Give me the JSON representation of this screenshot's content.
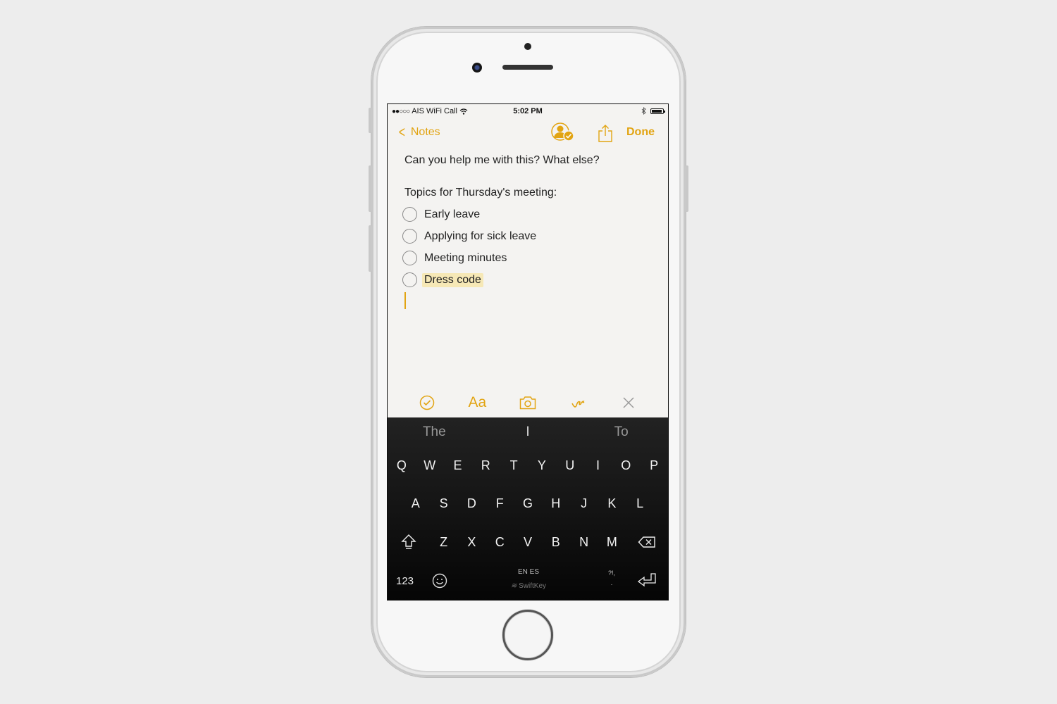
{
  "status_bar": {
    "carrier": "AIS WiFi Call",
    "signal_dots": "●●○○○",
    "time": "5:02 PM"
  },
  "nav": {
    "back_label": "Notes",
    "done_label": "Done"
  },
  "note": {
    "line1": "Can you help me with this? What else?",
    "heading": "Topics for Thursday's meeting:",
    "checklist": [
      {
        "label": "Early leave",
        "checked": false
      },
      {
        "label": "Applying for sick leave",
        "checked": false
      },
      {
        "label": "Meeting minutes",
        "checked": false
      },
      {
        "label": "Dress code",
        "checked": false,
        "highlighted": true
      }
    ]
  },
  "toolbar": {
    "items": [
      "checklist-icon",
      "text-format-icon",
      "camera-icon",
      "sketch-icon",
      "close-icon"
    ],
    "format_label": "Aa"
  },
  "keyboard": {
    "predictions": [
      "The",
      "I",
      "To"
    ],
    "row1": [
      "Q",
      "W",
      "E",
      "R",
      "T",
      "Y",
      "U",
      "I",
      "O",
      "P"
    ],
    "row2": [
      "A",
      "S",
      "D",
      "F",
      "G",
      "H",
      "J",
      "K",
      "L"
    ],
    "row3": [
      "Z",
      "X",
      "C",
      "V",
      "B",
      "N",
      "M"
    ],
    "numbers_label": "123",
    "languages": "EN ES",
    "brand": "SwiftKey",
    "punct_top": "?!,",
    "punct_bottom": "."
  },
  "colors": {
    "accent": "#e2a412",
    "highlight": "#f6e8b6",
    "keyboard_bg": "#141414"
  }
}
